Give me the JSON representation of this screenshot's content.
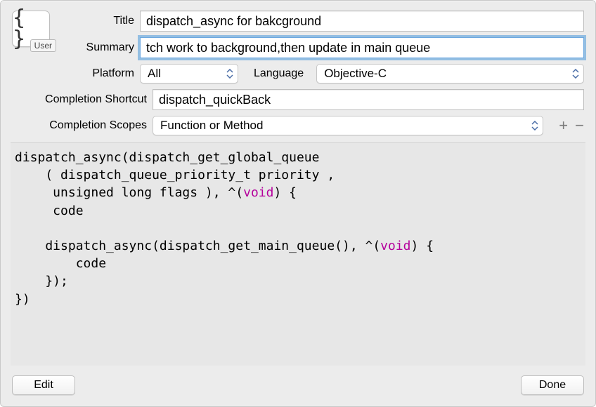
{
  "icon": {
    "badge": "User"
  },
  "labels": {
    "title": "Title",
    "summary": "Summary",
    "platform": "Platform",
    "language": "Language",
    "completion_shortcut": "Completion Shortcut",
    "completion_scopes": "Completion Scopes"
  },
  "fields": {
    "title": "dispatch_async for bakcground",
    "summary": "tch work to background,then update in main queue",
    "platform": "All",
    "language": "Objective-C",
    "completion_shortcut": "dispatch_quickBack",
    "completion_scopes": "Function or Method"
  },
  "code": {
    "l1a": "dispatch_async(dispatch_get_global_queue",
    "l2a": "    ( dispatch_queue_priority_t priority ,",
    "l3a": "     unsigned long flags ), ^(",
    "l3kw": "void",
    "l3b": ") {",
    "l4": "     code",
    "blank": "",
    "l6a": "    dispatch_async(dispatch_get_main_queue(), ^(",
    "l6kw": "void",
    "l6b": ") {",
    "l7": "        code",
    "l8": "    });",
    "l9": "})"
  },
  "buttons": {
    "edit": "Edit",
    "done": "Done",
    "add": "+",
    "remove": "−"
  }
}
